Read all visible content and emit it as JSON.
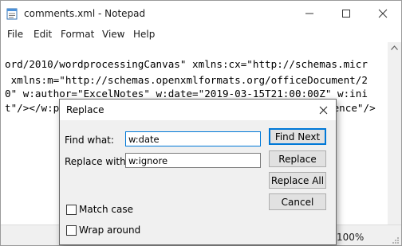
{
  "window": {
    "title": "comments.xml - Notepad"
  },
  "menubar": {
    "items": [
      "File",
      "Edit",
      "Format",
      "View",
      "Help"
    ]
  },
  "editor": {
    "lines": [
      "ord/2010/wordprocessingCanvas\" xmlns:cx=\"http://schemas.micr",
      " xmlns:m=\"http://schemas.openxmlformats.org/officeDocument/2",
      "0\" w:author=\"ExcelNotes\" w:date=\"2019-03-15T21:00:00Z\" w:ini",
      "t\"/></w:p",
      "rence\"/>"
    ]
  },
  "statusbar": {
    "zoom": "100%"
  },
  "dialog": {
    "title": "Replace",
    "find_label": "Find what:",
    "find_value": "w:date",
    "replace_label": "Replace with:",
    "replace_value": "w:ignore",
    "match_case_label": "Match case",
    "wrap_around_label": "Wrap around",
    "buttons": {
      "find_next": "Find Next",
      "replace": "Replace",
      "replace_all": "Replace All",
      "cancel": "Cancel"
    }
  }
}
